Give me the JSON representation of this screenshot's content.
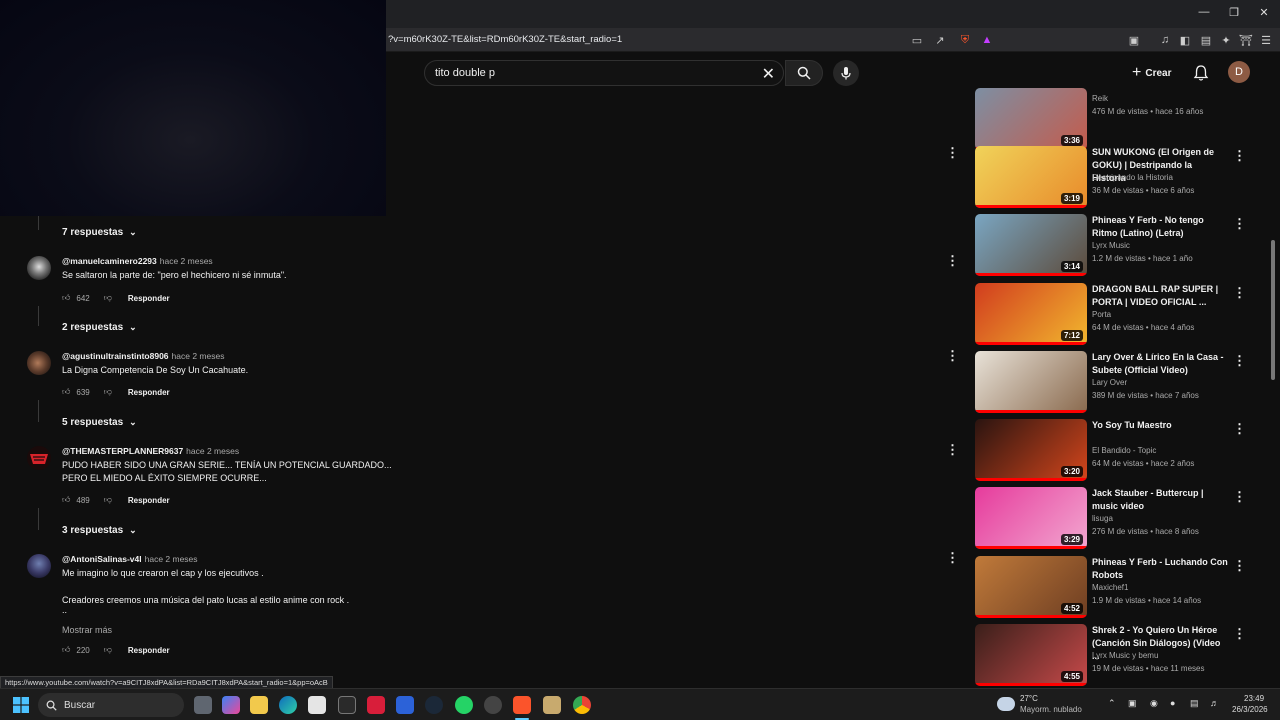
{
  "browser": {
    "url": "?v=m60rK30Z-TE&list=RDm60rK30Z-TE&start_radio=1",
    "status_url": "https://www.youtube.com/watch?v=a9CITJ8xdPA&list=RDa9CITJ8xdPA&start_radio=1&pp=oAcB"
  },
  "header": {
    "search_value": "tito double p",
    "create_label": "Crear",
    "avatar_letter": "D"
  },
  "comments": [
    {
      "replies_top_label": "7 respuestas",
      "author": "@manuelcaminero2293",
      "time": "hace 2 meses",
      "text": "Se saltaron la parte de: \"pero el hechicero ni sé inmuta\".",
      "likes": "642",
      "reply_label": "Responder",
      "replies_label": "2 respuestas"
    },
    {
      "author": "@agustinultrainstinto8906",
      "time": "hace 2 meses",
      "text": "La Digna Competencia De Soy Un Cacahuate.",
      "likes": "639",
      "reply_label": "Responder",
      "replies_label": "5 respuestas"
    },
    {
      "author": "@THEMASTERPLANNER9637",
      "time": "hace 2 meses",
      "text": "PUDO HABER SIDO UNA GRAN SERIE... TENÍA UN POTENCIAL GUARDADO...",
      "text2": "PERO EL MIEDO AL ÉXITO SIEMPRE OCURRE...",
      "likes": "489",
      "reply_label": "Responder",
      "replies_label": "3 respuestas"
    },
    {
      "author": "@AntoniSalinas-v4l",
      "time": "hace 2 meses",
      "text": "Me imagino lo que crearon el cap y los ejecutivos .",
      "text2": "Creadores creemos una música del pato lucas al estilo anime con rock .",
      "text3": "..",
      "more_label": "Mostrar más",
      "likes": "220",
      "reply_label": "Responder"
    }
  ],
  "playlist": [
    {
      "title": "",
      "channel": "Reik",
      "meta": "476 M de vistas • hace 16 años",
      "duration": "3:36",
      "thumb_colors": [
        "#7d8fa3",
        "#c45b4c"
      ]
    },
    {
      "title": "SUN WUKONG (El Origen de GOKU) | Destripando la Historia",
      "channel": "Destripando la Historia",
      "meta": "36 M de vistas • hace 6 años",
      "duration": "3:19",
      "thumb_colors": [
        "#f0d35a",
        "#e88a2a"
      ]
    },
    {
      "title": "Phineas Y Ferb - No tengo Ritmo (Latino) (Letra)",
      "channel": "Lyrx Music",
      "meta": "1.2 M de vistas • hace 1 año",
      "duration": "3:14",
      "thumb_colors": [
        "#7aa6c2",
        "#5c4a3a"
      ]
    },
    {
      "title": "DRAGON BALL RAP SUPER | PORTA | VIDEO OFICIAL ...",
      "channel": "Porta",
      "meta": "64 M de vistas • hace 4 años",
      "duration": "7:12",
      "thumb_colors": [
        "#d13c1e",
        "#f2b72e"
      ]
    },
    {
      "title": "Lary Over & Lírico En la Casa - Subete (Official Video)",
      "channel": "Lary Over",
      "meta": "389 M de vistas • hace 7 años",
      "duration": "",
      "thumb_colors": [
        "#e8e2d8",
        "#8a6a4e"
      ]
    },
    {
      "title": "Yo Soy Tu Maestro",
      "channel": "El Bandido - Topic",
      "meta": "64 M de vistas • hace 2 años",
      "duration": "3:20",
      "thumb_colors": [
        "#2a1410",
        "#d4461c"
      ]
    },
    {
      "title": "Jack Stauber - Buttercup | music video",
      "channel": "lisuga",
      "meta": "276 M de vistas • hace 8 años",
      "duration": "3:29",
      "thumb_colors": [
        "#e63b9c",
        "#f2a7d0"
      ]
    },
    {
      "title": "Phineas Y Ferb - Luchando Con Robots",
      "channel": "Maxichef1",
      "meta": "1.9 M de vistas • hace 14 años",
      "duration": "4:52",
      "thumb_colors": [
        "#c07a3a",
        "#6e3e22"
      ]
    },
    {
      "title": "Shrek 2 - Yo Quiero Un Héroe (Canción Sin Diálogos) (Video ...",
      "channel": "Lyrx Music y bemu",
      "meta": "19 M de vistas • hace 11 meses",
      "duration": "4:55",
      "thumb_colors": [
        "#3a1f1a",
        "#c74a4a"
      ]
    }
  ],
  "taskbar": {
    "search_label": "Buscar",
    "weather_temp": "27°C",
    "weather_desc": "Mayorm. nublado",
    "time": "23:49",
    "date": "26/3/2026"
  },
  "colors": {
    "accent_red": "#ff0000",
    "background": "#0f0f0f"
  }
}
